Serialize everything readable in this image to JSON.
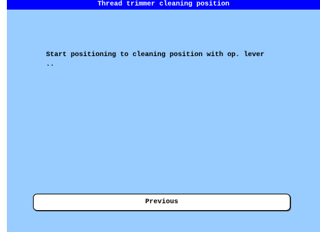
{
  "window": {
    "title": "Thread trimmer cleaning position"
  },
  "main": {
    "message_line1": "Start positioning to cleaning position with op. lever",
    "message_line2": ".."
  },
  "buttons": {
    "previous_label": "Previous"
  },
  "colors": {
    "titlebar_bg": "#0000ff",
    "titlebar_text": "#ffffff",
    "screen_bg": "#99ccff",
    "button_bg": "#ffffff"
  }
}
